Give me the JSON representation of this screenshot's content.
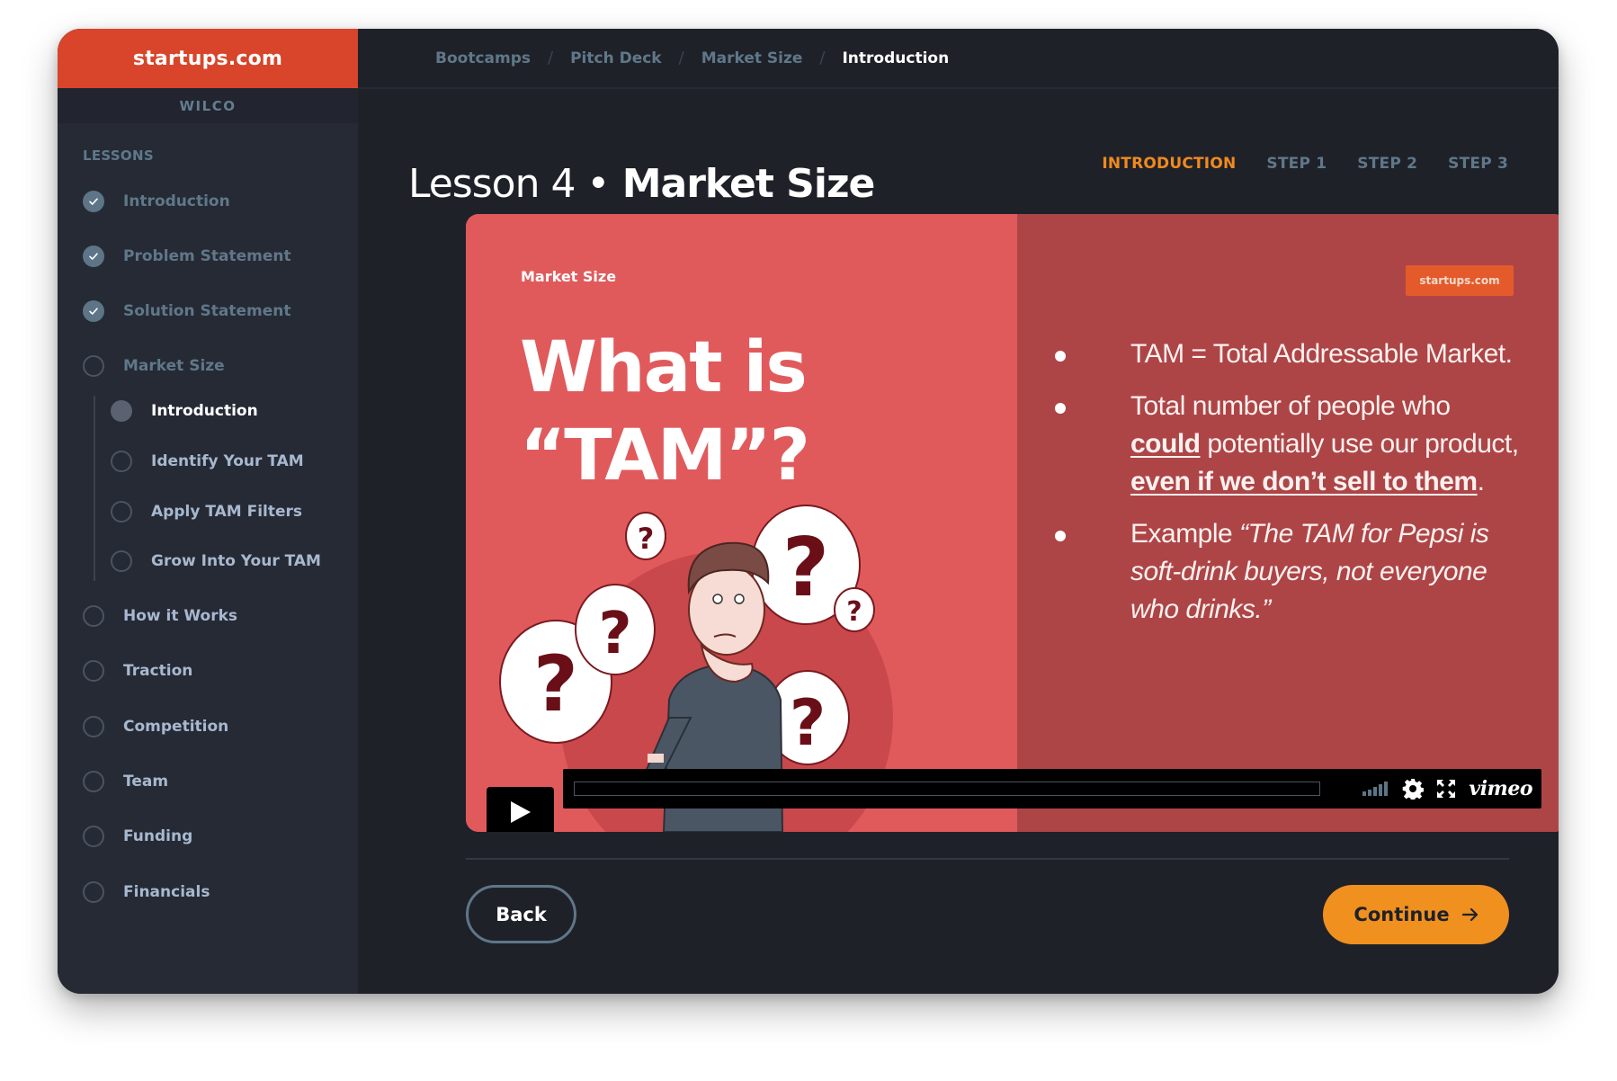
{
  "brand": {
    "logo_text": "startups.com",
    "org_label": "WILCO",
    "logo_color": "#d8452a"
  },
  "sidebar": {
    "section_label": "LESSONS",
    "items": [
      {
        "label": "Introduction",
        "status": "completed"
      },
      {
        "label": "Problem Statement",
        "status": "completed"
      },
      {
        "label": "Solution Statement",
        "status": "completed"
      },
      {
        "label": "Market Size",
        "status": "in-progress",
        "children": [
          {
            "label": "Introduction",
            "status": "current"
          },
          {
            "label": "Identify Your TAM",
            "status": "incomplete"
          },
          {
            "label": "Apply TAM Filters",
            "status": "incomplete"
          },
          {
            "label": "Grow Into Your TAM",
            "status": "incomplete"
          }
        ]
      },
      {
        "label": "How it Works",
        "status": "incomplete"
      },
      {
        "label": "Traction",
        "status": "incomplete"
      },
      {
        "label": "Competition",
        "status": "incomplete"
      },
      {
        "label": "Team",
        "status": "incomplete"
      },
      {
        "label": "Funding",
        "status": "incomplete"
      },
      {
        "label": "Financials",
        "status": "incomplete"
      }
    ]
  },
  "breadcrumb": [
    "Bootcamps",
    "Pitch Deck",
    "Market Size",
    "Introduction"
  ],
  "page": {
    "title_prefix": "Lesson 4 •",
    "title_main": "Market Size"
  },
  "steps": [
    {
      "label": "INTRODUCTION",
      "active": true
    },
    {
      "label": "STEP 1",
      "active": false
    },
    {
      "label": "STEP 2",
      "active": false
    },
    {
      "label": "STEP 3",
      "active": false
    }
  ],
  "video": {
    "slide_kicker": "Market Size",
    "slide_heading_line1": "What is",
    "slide_heading_line2": "“TAM”?",
    "badge": "startups.com",
    "bullets": {
      "b1": "TAM = Total Addressable Market.",
      "b2_pre": "",
      "b2_u1": "could",
      "b2_mid": " potentially use our product, ",
      "b2_lead": "Total number of people who ",
      "b2_u2": "even if we don’t sell to them",
      "b2_end": ".",
      "b3_pre": "Example ",
      "b3_italic": "“The TAM for Pepsi is soft-drink buyers, not everyone who drinks.”"
    },
    "player": {
      "provider": "vimeo",
      "progress_fraction": 0,
      "icons": [
        "play-icon",
        "volume-bars-icon",
        "settings-gear-icon",
        "fullscreen-icon"
      ]
    },
    "colors": {
      "slide_left": "#e05a5c",
      "slide_right": "#ad4547"
    }
  },
  "actions": {
    "back_label": "Back",
    "continue_label": "Continue",
    "accent_color": "#f0901e"
  }
}
